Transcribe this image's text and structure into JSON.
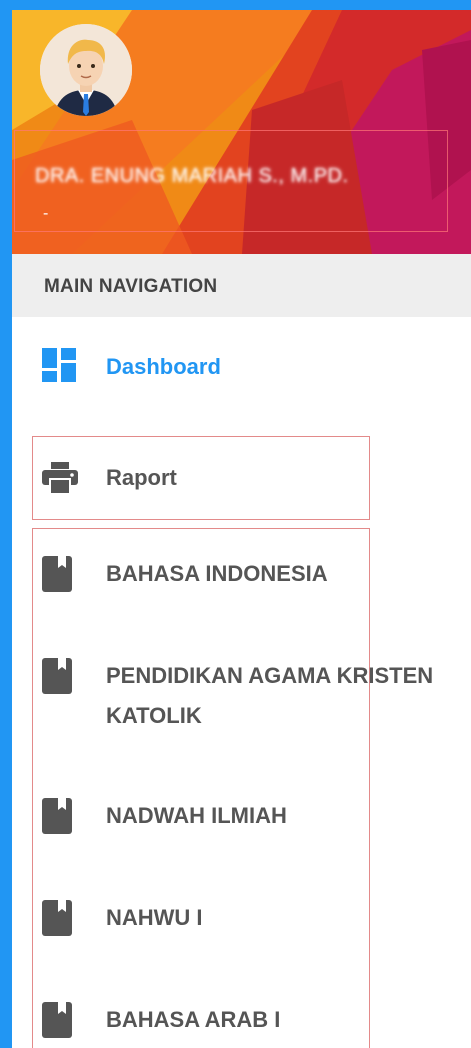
{
  "user": {
    "name": "DRA. ENUNG MARIAH S., M.PD.",
    "subtitle": "-"
  },
  "nav": {
    "header": "MAIN NAVIGATION",
    "dashboard_label": "Dashboard",
    "raport_label": "Raport",
    "courses": [
      "BAHASA INDONESIA",
      "PENDIDIKAN AGAMA KRISTEN KATOLIK",
      "NADWAH ILMIAH",
      "NAHWU I",
      "BAHASA ARAB I"
    ]
  },
  "colors": {
    "accent": "#2196f3",
    "icon_gray": "#555555",
    "header_gradient": [
      "#f6a31a",
      "#ef6c1d",
      "#d32f2f",
      "#c2185b"
    ]
  },
  "icons": {
    "dashboard": "dashboard-icon",
    "raport": "printer-icon",
    "course": "book-icon"
  }
}
